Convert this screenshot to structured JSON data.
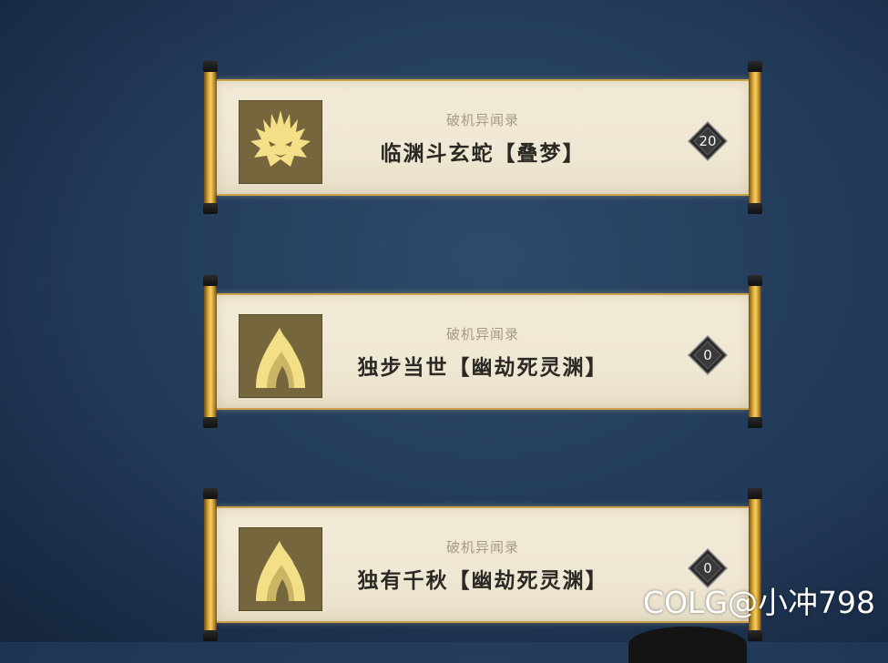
{
  "scrolls": [
    {
      "subtitle": "破机异闻录",
      "title": "临渊斗玄蛇【叠梦】",
      "badge": "20",
      "emblem_icon": "dragon-head-icon"
    },
    {
      "subtitle": "破机异闻录",
      "title": "独步当世【幽劫死灵渊】",
      "badge": "0",
      "emblem_icon": "flame-spirit-icon"
    },
    {
      "subtitle": "破机异闻录",
      "title": "独有千秋【幽劫死灵渊】",
      "badge": "0",
      "emblem_icon": "flame-spirit-icon"
    }
  ],
  "watermark": "COLG@小冲798",
  "colors": {
    "background": "#243d5c",
    "gold": "#e0ad3c",
    "paper": "#efe8d4",
    "emblem_bg": "#76663d",
    "emblem_fg": "#f3df86"
  }
}
